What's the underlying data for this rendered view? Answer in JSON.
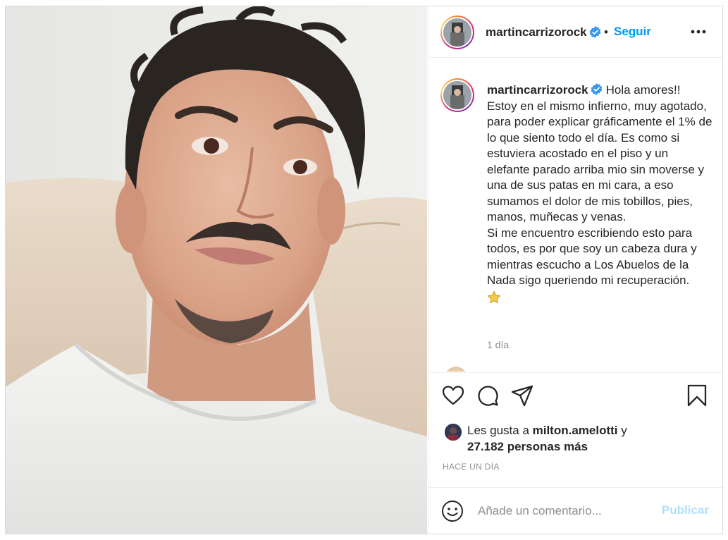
{
  "post": {
    "username": "martincarrizorock",
    "verified": true,
    "follow_label": "Seguir",
    "dot": "•",
    "more_icon": "more-horizontal-icon"
  },
  "caption": {
    "username": "martincarrizorock",
    "text": "Hola amores!!\nEstoy en el mismo infierno, muy agotado, para poder explicar gráficamente el 1% de lo que siento todo el día. Es como si estuviera acostado en el piso y un elefante parado arriba mio sin moverse y una de sus patas en mi cara, a eso sumamos el dolor de mis tobillos, pies, manos, muñecas y venas.\nSi me encuentro escribiendo esto para todos, es por que soy un cabeza dura y mientras escucho a Los Abuelos de la Nada sigo queriendo mi recuperación.",
    "emoji": "star-emoji",
    "time": "1 día"
  },
  "actions": {
    "like_icon": "heart-icon",
    "comment_icon": "comment-icon",
    "share_icon": "paper-plane-icon",
    "save_icon": "bookmark-icon"
  },
  "likes": {
    "prefix": "Les gusta a ",
    "user": "milton.amelotti",
    "suffix": " y",
    "others": "27.182 personas más"
  },
  "post_time": "HACE UN DÍA",
  "comment_box": {
    "placeholder": "Añade un comentario...",
    "publish_label": "Publicar",
    "emoji_icon": "smiley-icon"
  },
  "colors": {
    "accent": "#0095f6",
    "publish_disabled": "#b2dffc",
    "muted": "#8e8e8e",
    "text": "#262626"
  }
}
